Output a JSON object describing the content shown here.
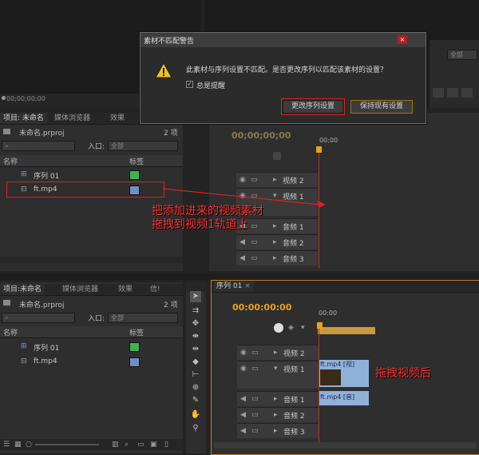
{
  "dialog": {
    "title": "素材不匹配警告",
    "message": "此素材与序列设置不匹配。是否更改序列以匹配该素材的设置？",
    "checkbox_label": "总是提醒",
    "checkbox_checked": true,
    "change_button": "更改序列设置",
    "keep_button": "保持现有设置"
  },
  "source_monitor": {
    "timecode": "00;00;00;00"
  },
  "program_top": {
    "dropdown": "全部"
  },
  "project_top": {
    "tabs": [
      "项目: 未命名",
      "媒体浏览器",
      "效果"
    ],
    "file_name": "未命名.prproj",
    "item_count": "2 项",
    "inout_label": "入口:",
    "inout_value": "全部",
    "col_name": "名称",
    "col_label": "标签",
    "items": [
      {
        "name": "序列 01",
        "color": "#3fb34f"
      },
      {
        "name": "ft.mp4",
        "color": "#6f8fc8"
      }
    ]
  },
  "timeline_top": {
    "timecode": "00;00;00;00",
    "ruler": "00;00",
    "tracks": [
      "视频 2",
      "视频 1",
      "音频 1",
      "音频 2",
      "音频 3"
    ]
  },
  "annotations": {
    "drag_line1": "把添加进来的视频素材",
    "drag_line2": "拖拽到视频1轨道上",
    "after": "拖拽视频后"
  },
  "project_bottom": {
    "tabs": [
      "项目:未命名",
      "媒体浏览器",
      "效果",
      "信!"
    ],
    "file_name": "未命名.prproj",
    "item_count": "2 项",
    "inout_label": "入口:",
    "inout_value": "全部",
    "col_name": "名称",
    "col_label": "标签",
    "items": [
      {
        "name": "序列 01",
        "color": "#3fb34f"
      },
      {
        "name": "ft.mp4",
        "color": "#6f8fc8"
      }
    ]
  },
  "timeline_bottom": {
    "tab": "序列 01",
    "timecode": "00:00:00:00",
    "ruler": "00:00",
    "tracks": [
      "视频 2",
      "视频 1",
      "音频 1",
      "音频 2",
      "音频 3"
    ],
    "video_clip": "ft.mp4 [视]",
    "audio_clip": "ft.mp4 [音]"
  },
  "tools": [
    "selection-tool",
    "track-select-tool",
    "ripple-edit-tool",
    "rolling-edit-tool",
    "rate-stretch-tool",
    "razor-tool",
    "slip-tool",
    "slide-tool",
    "pen-tool",
    "hand-tool",
    "zoom-tool"
  ]
}
